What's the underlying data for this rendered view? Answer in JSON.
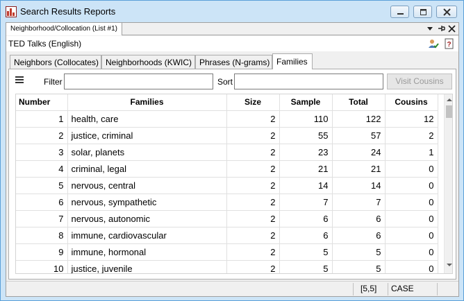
{
  "window": {
    "title": "Search Results Reports"
  },
  "doc_tab": {
    "label": "Neighborhood/Collocation (List #1)"
  },
  "corpus": {
    "name": "TED Talks (English)"
  },
  "tabs": [
    {
      "label": "Neighbors (Collocates)"
    },
    {
      "label": "Neighborhoods (KWIC)"
    },
    {
      "label": "Phrases (N-grams)"
    },
    {
      "label": "Families"
    }
  ],
  "toolbar": {
    "filter_label": "Filter",
    "filter_value": "",
    "sort_label": "Sort",
    "sort_value": "",
    "visit_cousins_label": "Visit Cousins"
  },
  "table": {
    "headers": [
      "Number",
      "Families",
      "Size",
      "Sample",
      "Total",
      "Cousins"
    ],
    "rows": [
      [
        "1",
        "health, care",
        "2",
        "110",
        "122",
        "12"
      ],
      [
        "2",
        "justice, criminal",
        "2",
        "55",
        "57",
        "2"
      ],
      [
        "3",
        "solar, planets",
        "2",
        "23",
        "24",
        "1"
      ],
      [
        "4",
        "criminal, legal",
        "2",
        "21",
        "21",
        "0"
      ],
      [
        "5",
        "nervous, central",
        "2",
        "14",
        "14",
        "0"
      ],
      [
        "6",
        "nervous, sympathetic",
        "2",
        "7",
        "7",
        "0"
      ],
      [
        "7",
        "nervous, autonomic",
        "2",
        "6",
        "6",
        "0"
      ],
      [
        "8",
        "immune, cardiovascular",
        "2",
        "6",
        "6",
        "0"
      ],
      [
        "9",
        "immune, hormonal",
        "2",
        "5",
        "5",
        "0"
      ],
      [
        "10",
        "justice, juvenile",
        "2",
        "5",
        "5",
        "0"
      ]
    ]
  },
  "status": {
    "position": "[5,5]",
    "mode": "CASE"
  },
  "icons": {
    "app": "bar-chart-icon",
    "doc_dropdown": "chevron-down-icon",
    "doc_pin": "pin-icon",
    "doc_close": "close-icon",
    "corpus_tool": "users-check-icon",
    "help": "help-icon",
    "menu": "hamburger-icon"
  },
  "colors": {
    "titlebar": "#cce4f7",
    "app_icon": "#c0392b"
  }
}
